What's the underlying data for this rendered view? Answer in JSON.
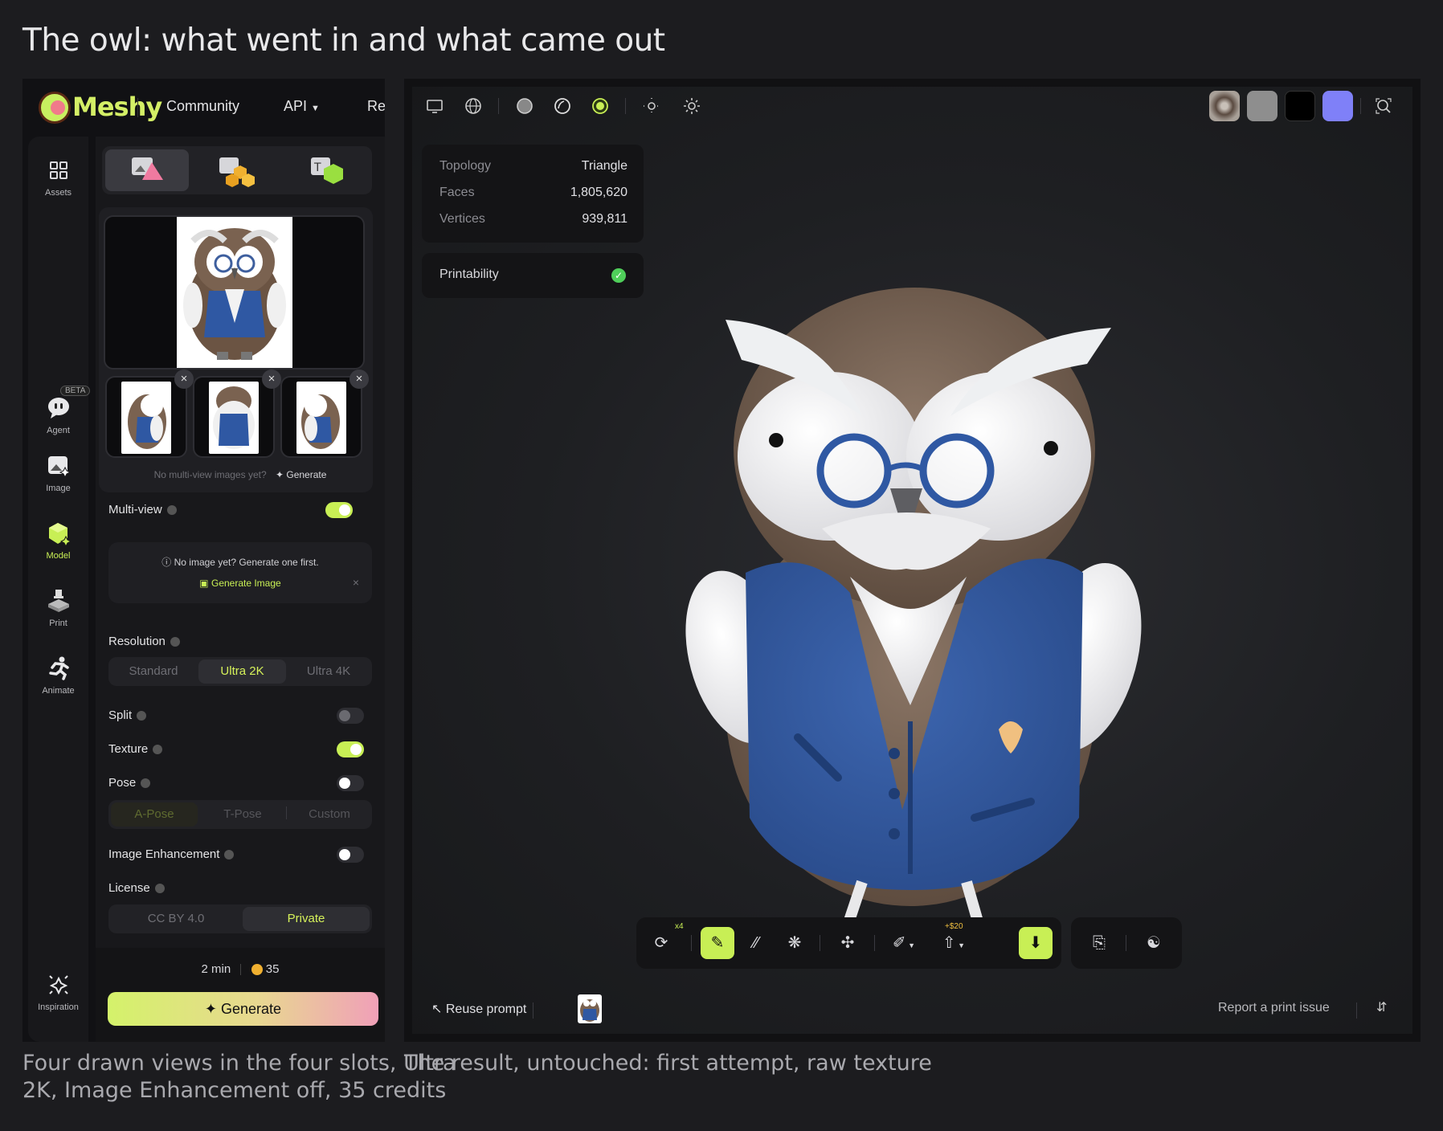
{
  "title": "The owl: what went in and what came out",
  "captions": {
    "left_line1": "Four drawn views in the four slots, Ultra",
    "left_line2": "2K, Image Enhancement off, 35 credits",
    "right": "The result, untouched: first attempt, raw texture"
  },
  "app": {
    "brand": "Meshy",
    "nav": {
      "community": "Community",
      "api": "API",
      "re": "Re"
    }
  },
  "rail": {
    "assets": "Assets",
    "beta": "BETA",
    "agent": "Agent",
    "image": "Image",
    "model": "Model",
    "print": "Print",
    "animate": "Animate",
    "inspiration": "Inspiration"
  },
  "panel": {
    "no_multiview": "No multi-view images yet?",
    "generate_link": "Generate",
    "multiview": "Multi-view",
    "no_image_note": "No image yet? Generate one first.",
    "generate_image": "Generate Image",
    "resolution": "Resolution",
    "res_options": [
      "Standard",
      "Ultra 2K",
      "Ultra 4K"
    ],
    "res_selected": "Ultra 2K",
    "split": "Split",
    "texture": "Texture",
    "pose": "Pose",
    "pose_options": [
      "A-Pose",
      "T-Pose",
      "Custom"
    ],
    "image_enhancement": "Image Enhancement",
    "license": "License",
    "license_options": [
      "CC BY 4.0",
      "Private"
    ],
    "license_selected": "Private",
    "time": "2 min",
    "credits": "35",
    "generate": "Generate",
    "toggles": {
      "multiview": true,
      "split": false,
      "texture": true,
      "pose": false,
      "image_enhancement": false
    }
  },
  "viewer": {
    "stats": [
      {
        "k": "Topology",
        "v": "Triangle"
      },
      {
        "k": "Faces",
        "v": "1,805,620"
      },
      {
        "k": "Vertices",
        "v": "939,811"
      }
    ],
    "printability": "Printability",
    "swatch_colors": [
      "#8a7f78",
      "#8e8e8e",
      "#000000",
      "#7f80f8"
    ],
    "toolbar": {
      "x4": "x4",
      "price": "+$20"
    },
    "reuse_prompt": "Reuse prompt",
    "report": "Report a print issue"
  },
  "colors": {
    "accent": "#c8ef55",
    "brand": "#d4ef66"
  }
}
